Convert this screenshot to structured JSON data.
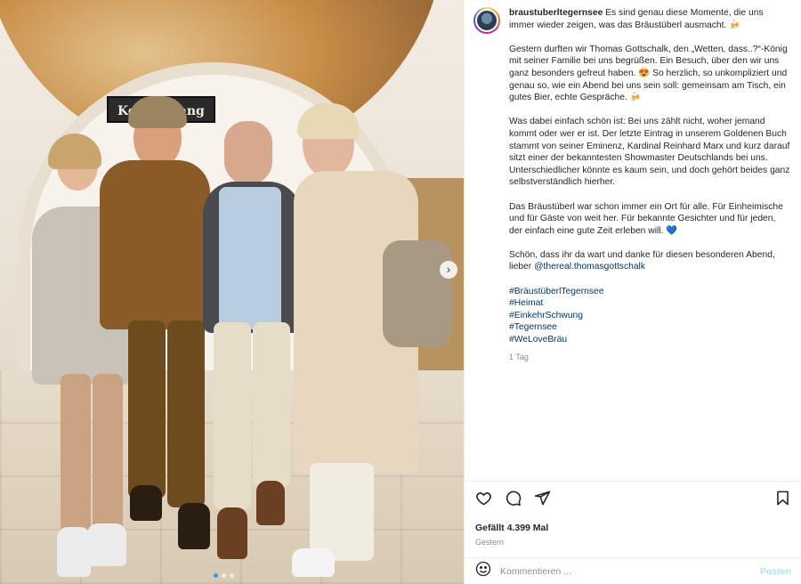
{
  "post": {
    "username": "braustuberltegernsee",
    "caption": [
      "Es sind genau diese Momente, die uns immer wieder zeigen, was das Bräustüberl ausmacht. 🍻",
      "Gestern durften wir Thomas Gottschalk, den „Wetten, dass..?“-König mit seiner Familie bei uns begrüßen. Ein Besuch, über den wir uns ganz besonders gefreut haben. 😍 So herzlich, so unkompliziert und genau so, wie ein Abend bei uns sein soll: gemeinsam am Tisch, ein gutes Bier, echte Gespräche. 🍻",
      "Was dabei einfach schön ist: Bei uns zählt nicht, woher jemand kommt oder wer er ist. Der letzte Eintrag in unserem Goldenen Buch stammt von seiner Eminenz, Kardinal Reinhard Marx und kurz darauf sitzt einer der bekanntesten Showmaster Deutschlands bei uns. Unterschiedlicher könnte es kaum sein, und doch gehört beides ganz selbstverständlich hierher.",
      "Das Bräustüberl war schon immer ein Ort für alle. Für Einheimische und für Gäste von weit her. Für bekannte Gesichter und für jeden, der einfach eine gute Zeit erleben will. 💙",
      "Schön, dass ihr da wart und danke für diesen besonderen Abend, lieber"
    ],
    "mention": "@thereal.thomasgottschalk",
    "hashtags": [
      "#BräustüberlTegernsee",
      "#Heimat",
      "#EinkehrSchwung",
      "#Tegernsee",
      "#WeLoveBräu"
    ],
    "time_ago": "1 Tag",
    "likes": "Gefällt 4.399 Mal",
    "date": "Gestern"
  },
  "photo": {
    "sign_text": "Kei… …gang"
  },
  "comment": {
    "placeholder": "Kommentieren ...",
    "post_label": "Posten"
  },
  "icons": {
    "like": "heart-icon",
    "comment": "comment-icon",
    "share": "share-icon",
    "save": "bookmark-icon",
    "emoji": "emoji-icon",
    "next": "chevron-right-icon"
  },
  "colors": {
    "link": "#00376b",
    "post_button": "#b2dffc",
    "muted": "#8e8e8e"
  }
}
